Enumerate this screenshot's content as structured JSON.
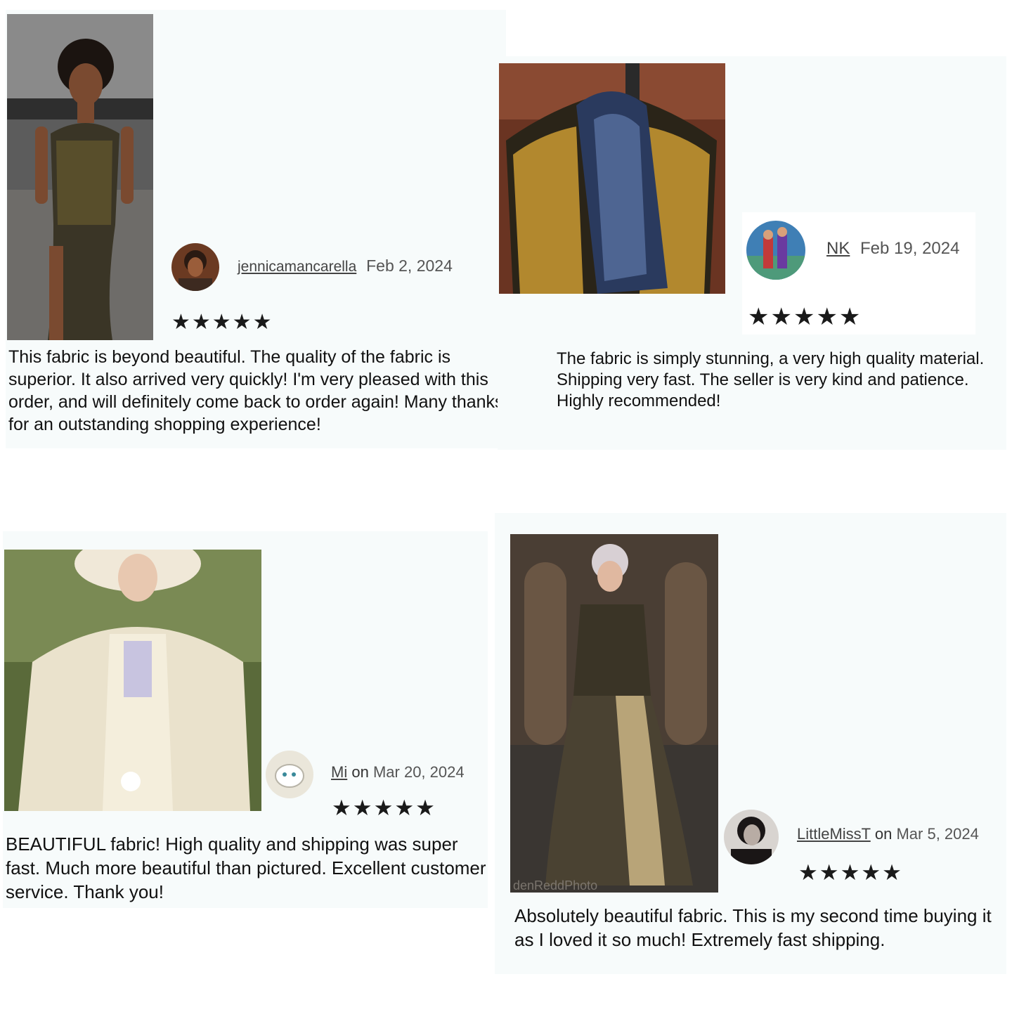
{
  "reviews": [
    {
      "username": "jennicamancarella",
      "connector": "",
      "date": "Feb 2, 2024",
      "rating": 5,
      "stars": "★★★★★",
      "text": "This fabric is beyond beautiful. The quality of the fabric is superior. It also arrived very quickly! I'm very pleased with this order, and will definitely come back to order again! Many thanks for an outstanding shopping experience!"
    },
    {
      "username": "NK",
      "connector": "",
      "date": "Feb 19, 2024",
      "rating": 5,
      "stars": "★★★★★",
      "text": "The fabric is simply stunning, a very high quality material. Shipping very fast. The seller is very kind and patience. Highly recommended!"
    },
    {
      "username": "Mi",
      "connector": "on",
      "date": "Mar 20, 2024",
      "rating": 5,
      "stars": "★★★★★",
      "text": "BEAUTIFUL fabric! High quality and shipping was super fast. Much   more beautiful than pictured. Excellent customer service. Thank you!"
    },
    {
      "username": "LittleMissT",
      "connector": "on",
      "date": "Mar 5, 2024",
      "rating": 5,
      "stars": "★★★★★",
      "text": "Absolutely beautiful fabric. This is my second time buying it as I loved it so much! Extremely fast shipping.",
      "photo_watermark": "denReddPhoto"
    }
  ]
}
